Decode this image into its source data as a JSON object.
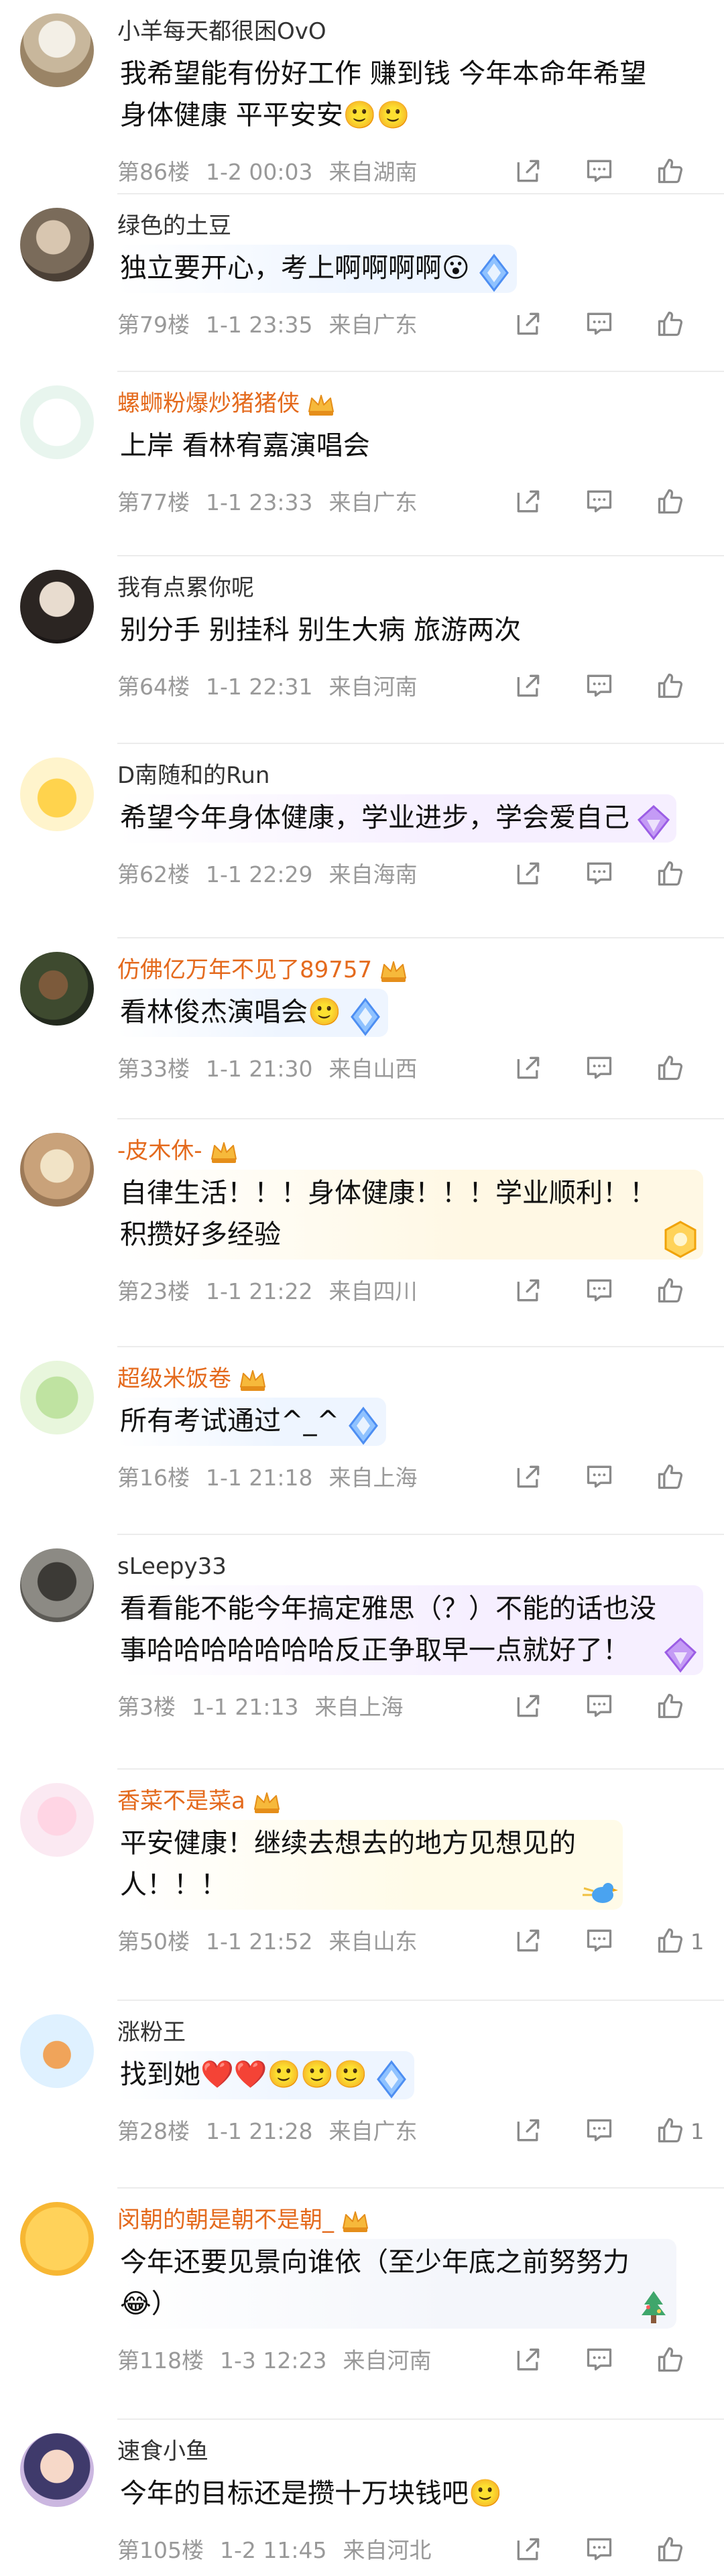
{
  "comments": [
    {
      "user": "小羊每天都很困OvO",
      "vip": false,
      "text": "我希望能有份好工作 赚到钱 今年本命年希望\n身体健康 平平安安🙂🙂",
      "floor": "第86楼",
      "time": "1-2 00:03",
      "loc": "来自湖南",
      "likes": "",
      "badge": "",
      "bubble": ""
    },
    {
      "user": "绿色的土豆",
      "vip": false,
      "text": "独立要开心，考上啊啊啊啊😮",
      "floor": "第79楼",
      "time": "1-1 23:35",
      "loc": "来自广东",
      "likes": "",
      "badge": "diamond",
      "bubble": "#eef5ff"
    },
    {
      "user": "螺蛳粉爆炒猪猪侠",
      "vip": true,
      "text": "上岸 看林宥嘉演唱会",
      "floor": "第77楼",
      "time": "1-1 23:33",
      "loc": "来自广东",
      "likes": "",
      "badge": "",
      "bubble": ""
    },
    {
      "user": "我有点累你呢",
      "vip": false,
      "text": "别分手 别挂科 别生大病 旅游两次",
      "floor": "第64楼",
      "time": "1-1 22:31",
      "loc": "来自河南",
      "likes": "",
      "badge": "",
      "bubble": ""
    },
    {
      "user": "D南随和的Run",
      "vip": false,
      "text": "希望今年身体健康，学业进步，学会爱自己",
      "floor": "第62楼",
      "time": "1-1 22:29",
      "loc": "来自海南",
      "likes": "",
      "badge": "purple",
      "bubble": "#f6efff"
    },
    {
      "user": "仿佛亿万年不见了89757",
      "vip": true,
      "text": "看林俊杰演唱会🙂",
      "floor": "第33楼",
      "time": "1-1 21:30",
      "loc": "来自山西",
      "likes": "",
      "badge": "diamond",
      "bubble": "#eef5ff"
    },
    {
      "user": "-皮木休-",
      "vip": true,
      "text": "自律生活！！！身体健康！！！学业顺利！！\n积攒好多经验",
      "floor": "第23楼",
      "time": "1-1 21:22",
      "loc": "来自四川",
      "likes": "",
      "badge": "gold",
      "bubble": "#fff8e4"
    },
    {
      "user": "超级米饭卷",
      "vip": true,
      "text": "所有考试通过^_^",
      "floor": "第16楼",
      "time": "1-1 21:18",
      "loc": "来自上海",
      "likes": "",
      "badge": "diamond",
      "bubble": "#eef5ff"
    },
    {
      "user": "sLeepy33",
      "vip": false,
      "text": "看看能不能今年搞定雅思（？）不能的话也没\n事哈哈哈哈哈哈哈反正争取早一点就好了！",
      "floor": "第3楼",
      "time": "1-1 21:13",
      "loc": "来自上海",
      "likes": "",
      "badge": "purple",
      "bubble": "#f6efff"
    },
    {
      "user": "香菜不是菜a",
      "vip": true,
      "text": "平安健康！继续去想去的地方见想见的\n人！！！",
      "floor": "第50楼",
      "time": "1-1 21:52",
      "loc": "来自山东",
      "likes": "1",
      "badge": "bird",
      "bubble": "#fffbe8"
    },
    {
      "user": "涨粉王",
      "vip": false,
      "text": "找到她❤️❤️🙂🙂🙂",
      "floor": "第28楼",
      "time": "1-1 21:28",
      "loc": "来自广东",
      "likes": "1",
      "badge": "diamond",
      "bubble": "#eef5ff"
    },
    {
      "user": "闵朝的朝是朝不是朝_",
      "vip": true,
      "text": "今年还要见景向谁依（至少年底之前努努力\n😂）",
      "floor": "第118楼",
      "time": "1-3 12:23",
      "loc": "来自河南",
      "likes": "",
      "badge": "tree",
      "bubble": "#f4f6fb"
    },
    {
      "user": "速食小鱼",
      "vip": false,
      "text": "今年的目标还是攒十万块钱吧🙂",
      "floor": "第105楼",
      "time": "1-2 11:45",
      "loc": "来自河北",
      "likes": "",
      "badge": "",
      "bubble": ""
    }
  ],
  "colors": {
    "vip_name": "#e46a1d",
    "normal_name": "#333333",
    "meta": "#999999",
    "icon": "#8a8a8a"
  }
}
